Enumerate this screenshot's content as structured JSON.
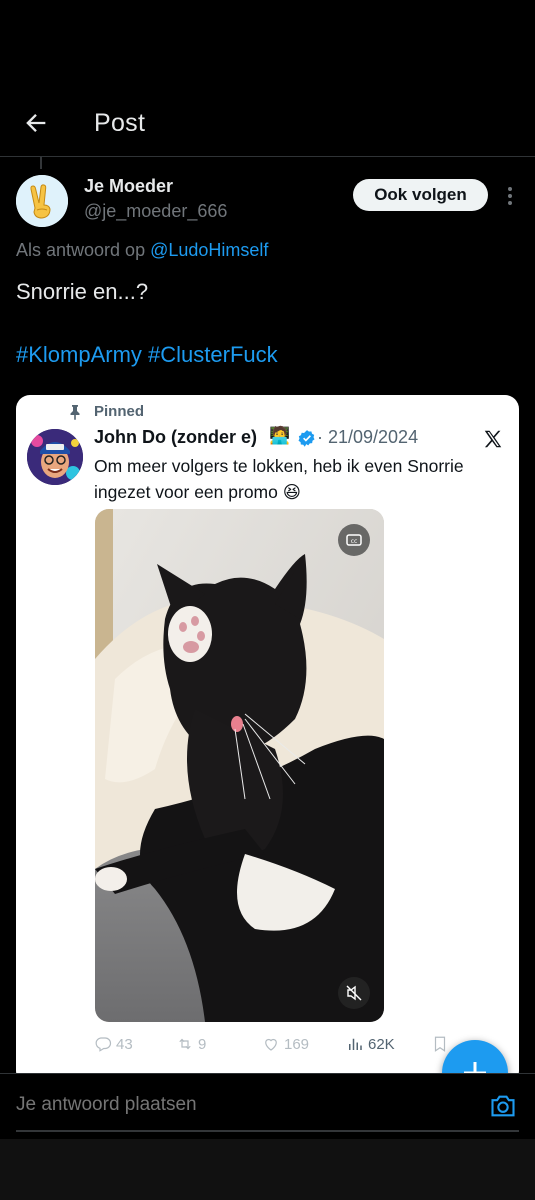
{
  "header": {
    "title": "Post",
    "back_icon": "arrow-left-icon"
  },
  "post": {
    "author_name": "Je Moeder",
    "author_handle": "@je_moeder_666",
    "follow_label": "Ook volgen",
    "reply_prefix": "Als antwoord op",
    "reply_mention": "@LudoHimself",
    "text": "Snorrie en...?",
    "hashtags": "#KlompArmy #ClusterFuck"
  },
  "quoted": {
    "pinned_label": "Pinned",
    "author_name": "John Do (zonder e)",
    "author_emoji": "🧑‍💻",
    "date": "· 21/09/2024",
    "text": "Om meer volgers te lokken, heb ik even Snorrie ingezet voor een promo 😆",
    "stats": {
      "replies": "43",
      "reposts": "9",
      "likes": "169",
      "views": "62K"
    }
  },
  "reply_bar": {
    "placeholder": "Je antwoord plaatsen"
  },
  "colors": {
    "accent": "#1d9bf0",
    "background": "#000000",
    "muted": "#71767b"
  }
}
